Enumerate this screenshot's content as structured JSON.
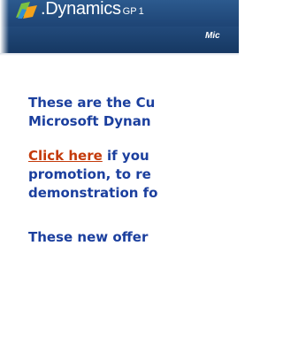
{
  "banner": {
    "logo_product": ".Dynamics",
    "logo_edition": "GP",
    "logo_suffix": "1",
    "company_text": "Mic"
  },
  "content": {
    "para1": [
      "These are the Cu",
      "Microsoft Dynan"
    ],
    "para2": {
      "link_text": "Click here",
      "line1_rest": " if you",
      "line2": "promotion, to re",
      "line3": "demonstration fo"
    },
    "para3": [
      "These new offer"
    ]
  },
  "colors": {
    "text": "#1b3f9e",
    "link": "#c43a0a",
    "banner": "#1f4677"
  }
}
